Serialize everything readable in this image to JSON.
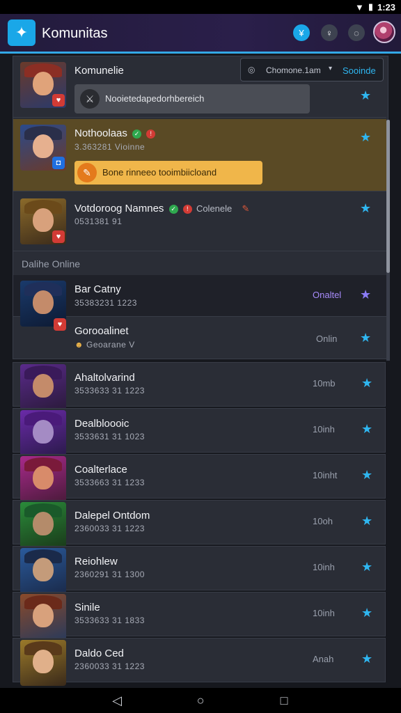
{
  "status_bar": {
    "time": "1:23",
    "wifi_icon": "wifi-icon",
    "battery_icon": "battery-icon"
  },
  "app": {
    "title": "Komunitas",
    "logo_icon": "app-logo-icon"
  },
  "header_buttons": [
    {
      "icon": "filter-icon",
      "color": "#1aa7e8"
    },
    {
      "icon": "bell-icon",
      "color": "#3d4250"
    },
    {
      "icon": "chat-icon",
      "color": "#3d4250"
    }
  ],
  "search": {
    "value": "Chomone.1am",
    "label": "Sooinde"
  },
  "featured": {
    "name": "Komunelie",
    "message": "Nooietedapedorhbereich"
  },
  "highlighted": {
    "name": "Nothoolaas",
    "sub": "3.363281 Vioinne",
    "note": "Bone rinneeo tooimbiicloand"
  },
  "third": {
    "name": "Votdoroog Namnes",
    "status": "Colenele",
    "sub": "0531381 91"
  },
  "section_label": "Dalihe Online",
  "online_rows": [
    {
      "name": "Bar Catny",
      "sub": "35383231 1223",
      "status": "Onaltel",
      "status_color": "#a78bfa",
      "star_color": "#8b7cf6"
    },
    {
      "name": "Gorooalinet",
      "sub": "Geoarane V",
      "status": "Onlin",
      "status_color": "#9aa0ad",
      "star_color": "#2fb6f0"
    }
  ],
  "list_rows": [
    {
      "name": "Ahaltolvarind",
      "sub": "3533633 31 1223",
      "status": "10mb"
    },
    {
      "name": "Dealbloooic",
      "sub": "3533631 31 1023",
      "status": "10inh"
    },
    {
      "name": "Coalterlace",
      "sub": "3533663 31 1233",
      "status": "10inht"
    },
    {
      "name": "Dalepel Ontdom",
      "sub": "2360033 31 1223",
      "status": "10oh"
    },
    {
      "name": "Reiohlew",
      "sub": "2360291 31 1300",
      "status": "10inh"
    },
    {
      "name": "Sinile",
      "sub": "3533633 31 1833",
      "status": "10inh"
    },
    {
      "name": "Daldo Ced",
      "sub": "2360033 31 1223",
      "status": "Anah"
    }
  ],
  "nav": {
    "back_icon": "back-icon",
    "home_icon": "home-icon",
    "recents_icon": "recents-icon"
  },
  "colors": {
    "accent": "#2fb6f0",
    "header_bg": "#2a1f4a",
    "highlight_bg": "#5a4a25",
    "note_bg": "#f0b64a"
  }
}
